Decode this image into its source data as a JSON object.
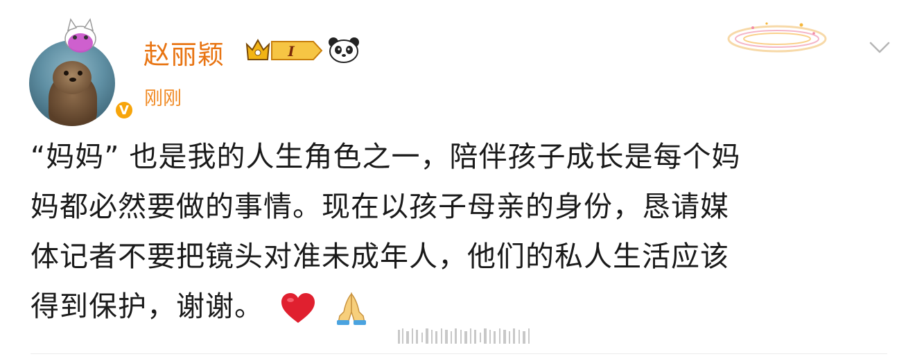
{
  "post": {
    "username": "赵丽颖",
    "level_badge": "I",
    "timestamp": "刚刚",
    "verified_mark": "V",
    "content": [
      "“妈妈” 也是我的人生角色之一，陪伴孩子成长是每个妈",
      "妈都必然要做的事情。现在以孩子母亲的身份，恳请媒",
      "体记者不要把镜头对准未成年人，他们的私人生活应该",
      "得到保护，谢谢。"
    ],
    "content_emojis": [
      "heart-emoji",
      "folded-hands-emoji"
    ],
    "icons": {
      "avatar_pendant": "cat-pendant-icon",
      "member_badge": "crown-badge-icon",
      "panda": "panda-icon",
      "expand": "chevron-down-icon",
      "decoration": "halo-decoration",
      "watermark": "weibo-watermark"
    },
    "colors": {
      "username": "#e87412",
      "timestamp": "#f08a24",
      "verified": "#f7a50b",
      "text": "#1a1a1a"
    }
  }
}
